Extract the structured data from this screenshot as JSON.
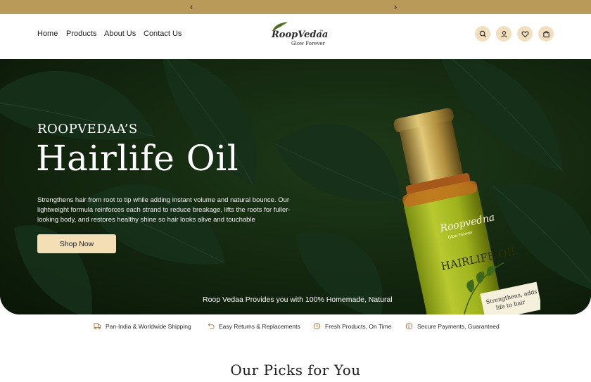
{
  "announcement": {
    "prev_icon": "chevron-left-icon",
    "next_icon": "chevron-right-icon",
    "prev": "‹",
    "next": "›"
  },
  "nav": {
    "items": [
      "Home",
      "Products",
      "About Us",
      "Contact Us"
    ]
  },
  "logo": {
    "brand": "RoopVedaa",
    "tm": "™",
    "tagline": "Glow Forever"
  },
  "header_icons": [
    "search-icon",
    "user-icon",
    "heart-icon",
    "bag-icon"
  ],
  "hero": {
    "kicker": "ROOPVEDAA’S",
    "title": "Hairlife Oil",
    "description": "Strengthens hair from root to tip while adding instant volume and natural bounce. Our lightweight formula reinforces each strand to reduce breakage, lifts the roots for fuller-looking body, and restores healthy shine so hair looks alive and touchable",
    "cta": "Shop Now",
    "ticker": "Roop Vedaa Provides you with 100% Homemade, Natural",
    "bottle_brand": "Roopvedna",
    "bottle_sub": "Glow Forever",
    "bottle_label": "HAIRLIFE OIL",
    "bottle_note_1": "Strengthens, adds",
    "bottle_note_2": "life to hair"
  },
  "features": [
    {
      "icon": "shipping-icon",
      "label": "Pan-India & Worldwide Shipping"
    },
    {
      "icon": "return-icon",
      "label": "Easy Returns & Replacements"
    },
    {
      "icon": "clock-icon",
      "label": "Fresh Products, On Time"
    },
    {
      "icon": "secure-icon",
      "label": "Secure Payments, Guaranteed"
    }
  ],
  "section_title": "Our Picks for You",
  "colors": {
    "gold": "#b99a58",
    "cream": "#f3deb6",
    "dark_green": "#0f1f0c"
  }
}
